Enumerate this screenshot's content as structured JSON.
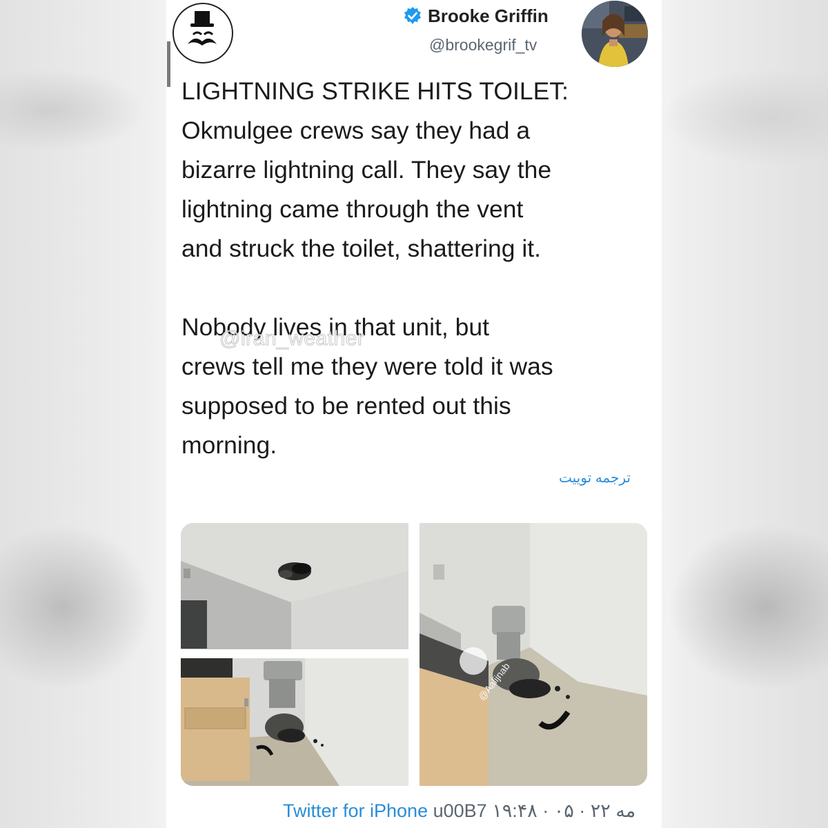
{
  "author": {
    "name": "Brooke Griffin",
    "handle": "@brookegrif_tv",
    "verified": true
  },
  "tweet": {
    "text": "LIGHTNING STRIKE HITS TOILET:\nOkmulgee crews say they had a\nbizarre lightning call. They say the\nlightning came through the vent\nand struck the toilet, shattering it.\n\nNobody lives in that unit, but\ncrews tell me they were told it was\nsupposed to be rented out this\nmorning.",
    "translate_label": "ترجمه توییت"
  },
  "watermarks": {
    "text_overlay": "@iran_weather",
    "photo_overlay": "@Aalijnab"
  },
  "footer": {
    "source": "Twitter for iPhone",
    "sep": "u00B7",
    "date": "۱۹:۴۸ · ۰۵ · مه ۲۲"
  },
  "icons": {
    "verified": "verified-badge-icon",
    "logo": "hat-mustache-logo-icon"
  },
  "colors": {
    "link": "#2a8dd8",
    "verified": "#1d9bf0",
    "text": "#1b1b1b",
    "muted": "#5b6670"
  }
}
